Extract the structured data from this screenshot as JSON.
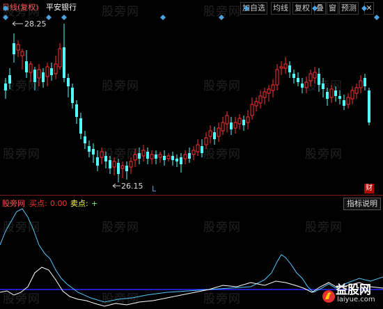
{
  "header": {
    "period": "日线(复权)",
    "stock_name": "平安银行"
  },
  "toolbar": {
    "items": [
      "加自选",
      "均线",
      "复权",
      "叠",
      "窗",
      "预测"
    ]
  },
  "price_labels": {
    "high": "28.25",
    "low": "26.15",
    "low_marker": "L"
  },
  "cai_label": "财",
  "indicator": {
    "name": "股旁网",
    "buy_label": "买点:",
    "buy_value": "0.00",
    "sell_label": "卖点:",
    "sell_value": "+",
    "explain_button": "指标说明"
  },
  "watermark": "股旁网",
  "brand": {
    "name": "益股网",
    "url": "laiyue.com"
  },
  "colors": {
    "up": "#ff3232",
    "down": "#54ffff",
    "diamond": "#4aa3e0",
    "cyan_line": "#54c8ff",
    "white_line": "#ffffff",
    "blue_line": "#2a2aff",
    "header_text": "#ff5050",
    "buy_text": "#ff3030",
    "sell_text": "#ffff55"
  }
}
